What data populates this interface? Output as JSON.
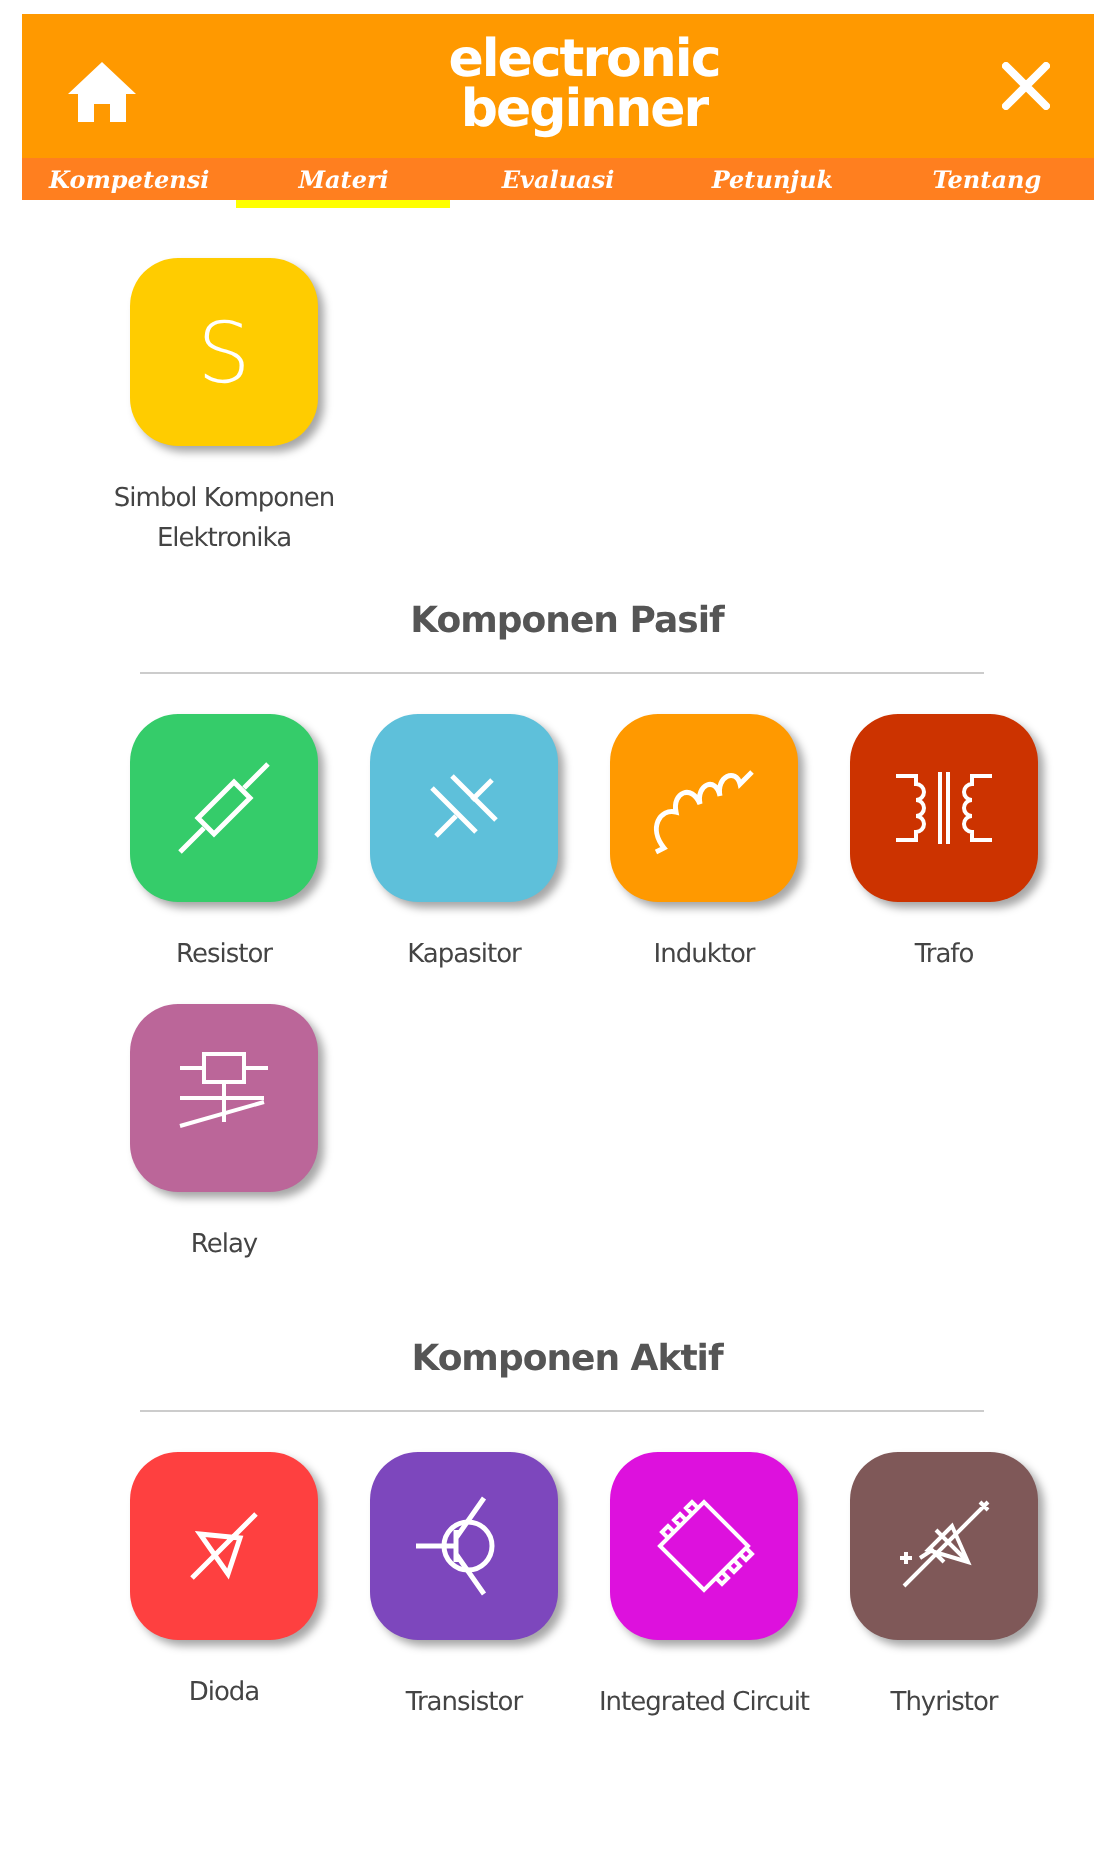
{
  "header": {
    "title_lines": [
      "electronic",
      "beginner"
    ]
  },
  "tabs": [
    {
      "label": "Kompetensi",
      "selected": false
    },
    {
      "label": "Materi",
      "selected": true
    },
    {
      "label": "Evaluasi",
      "selected": false
    },
    {
      "label": "Petunjuk",
      "selected": false
    },
    {
      "label": "Tentang",
      "selected": false
    }
  ],
  "sections": [
    {
      "items": [
        {
          "kind": "letter",
          "glyph": "S",
          "label": "Simbol Komponen Elektronika",
          "color": "#ffcc00"
        }
      ]
    },
    {
      "heading": "Komponen Pasif",
      "items": [
        {
          "kind": "resistor",
          "label": "Resistor",
          "color": "#35cc6a"
        },
        {
          "kind": "capacitor",
          "label": "Kapasitor",
          "color": "#5ec0da"
        },
        {
          "kind": "inductor",
          "label": "Induktor",
          "color": "#ff9900"
        },
        {
          "kind": "transformer",
          "label": "Trafo",
          "color": "#cc3300"
        },
        {
          "kind": "relay",
          "label": "Relay",
          "color": "#bb6699"
        }
      ]
    },
    {
      "heading": "Komponen Aktif",
      "items": [
        {
          "kind": "diode",
          "label": "Dioda",
          "color": "#fe4040"
        },
        {
          "kind": "transistor",
          "label": "Transistor",
          "color": "#7d47bd"
        },
        {
          "kind": "ic",
          "label": "Integrated Circuit",
          "color": "#dd11dd"
        },
        {
          "kind": "thyristor",
          "label": "Thyristor",
          "color": "#7f5858"
        }
      ]
    }
  ]
}
